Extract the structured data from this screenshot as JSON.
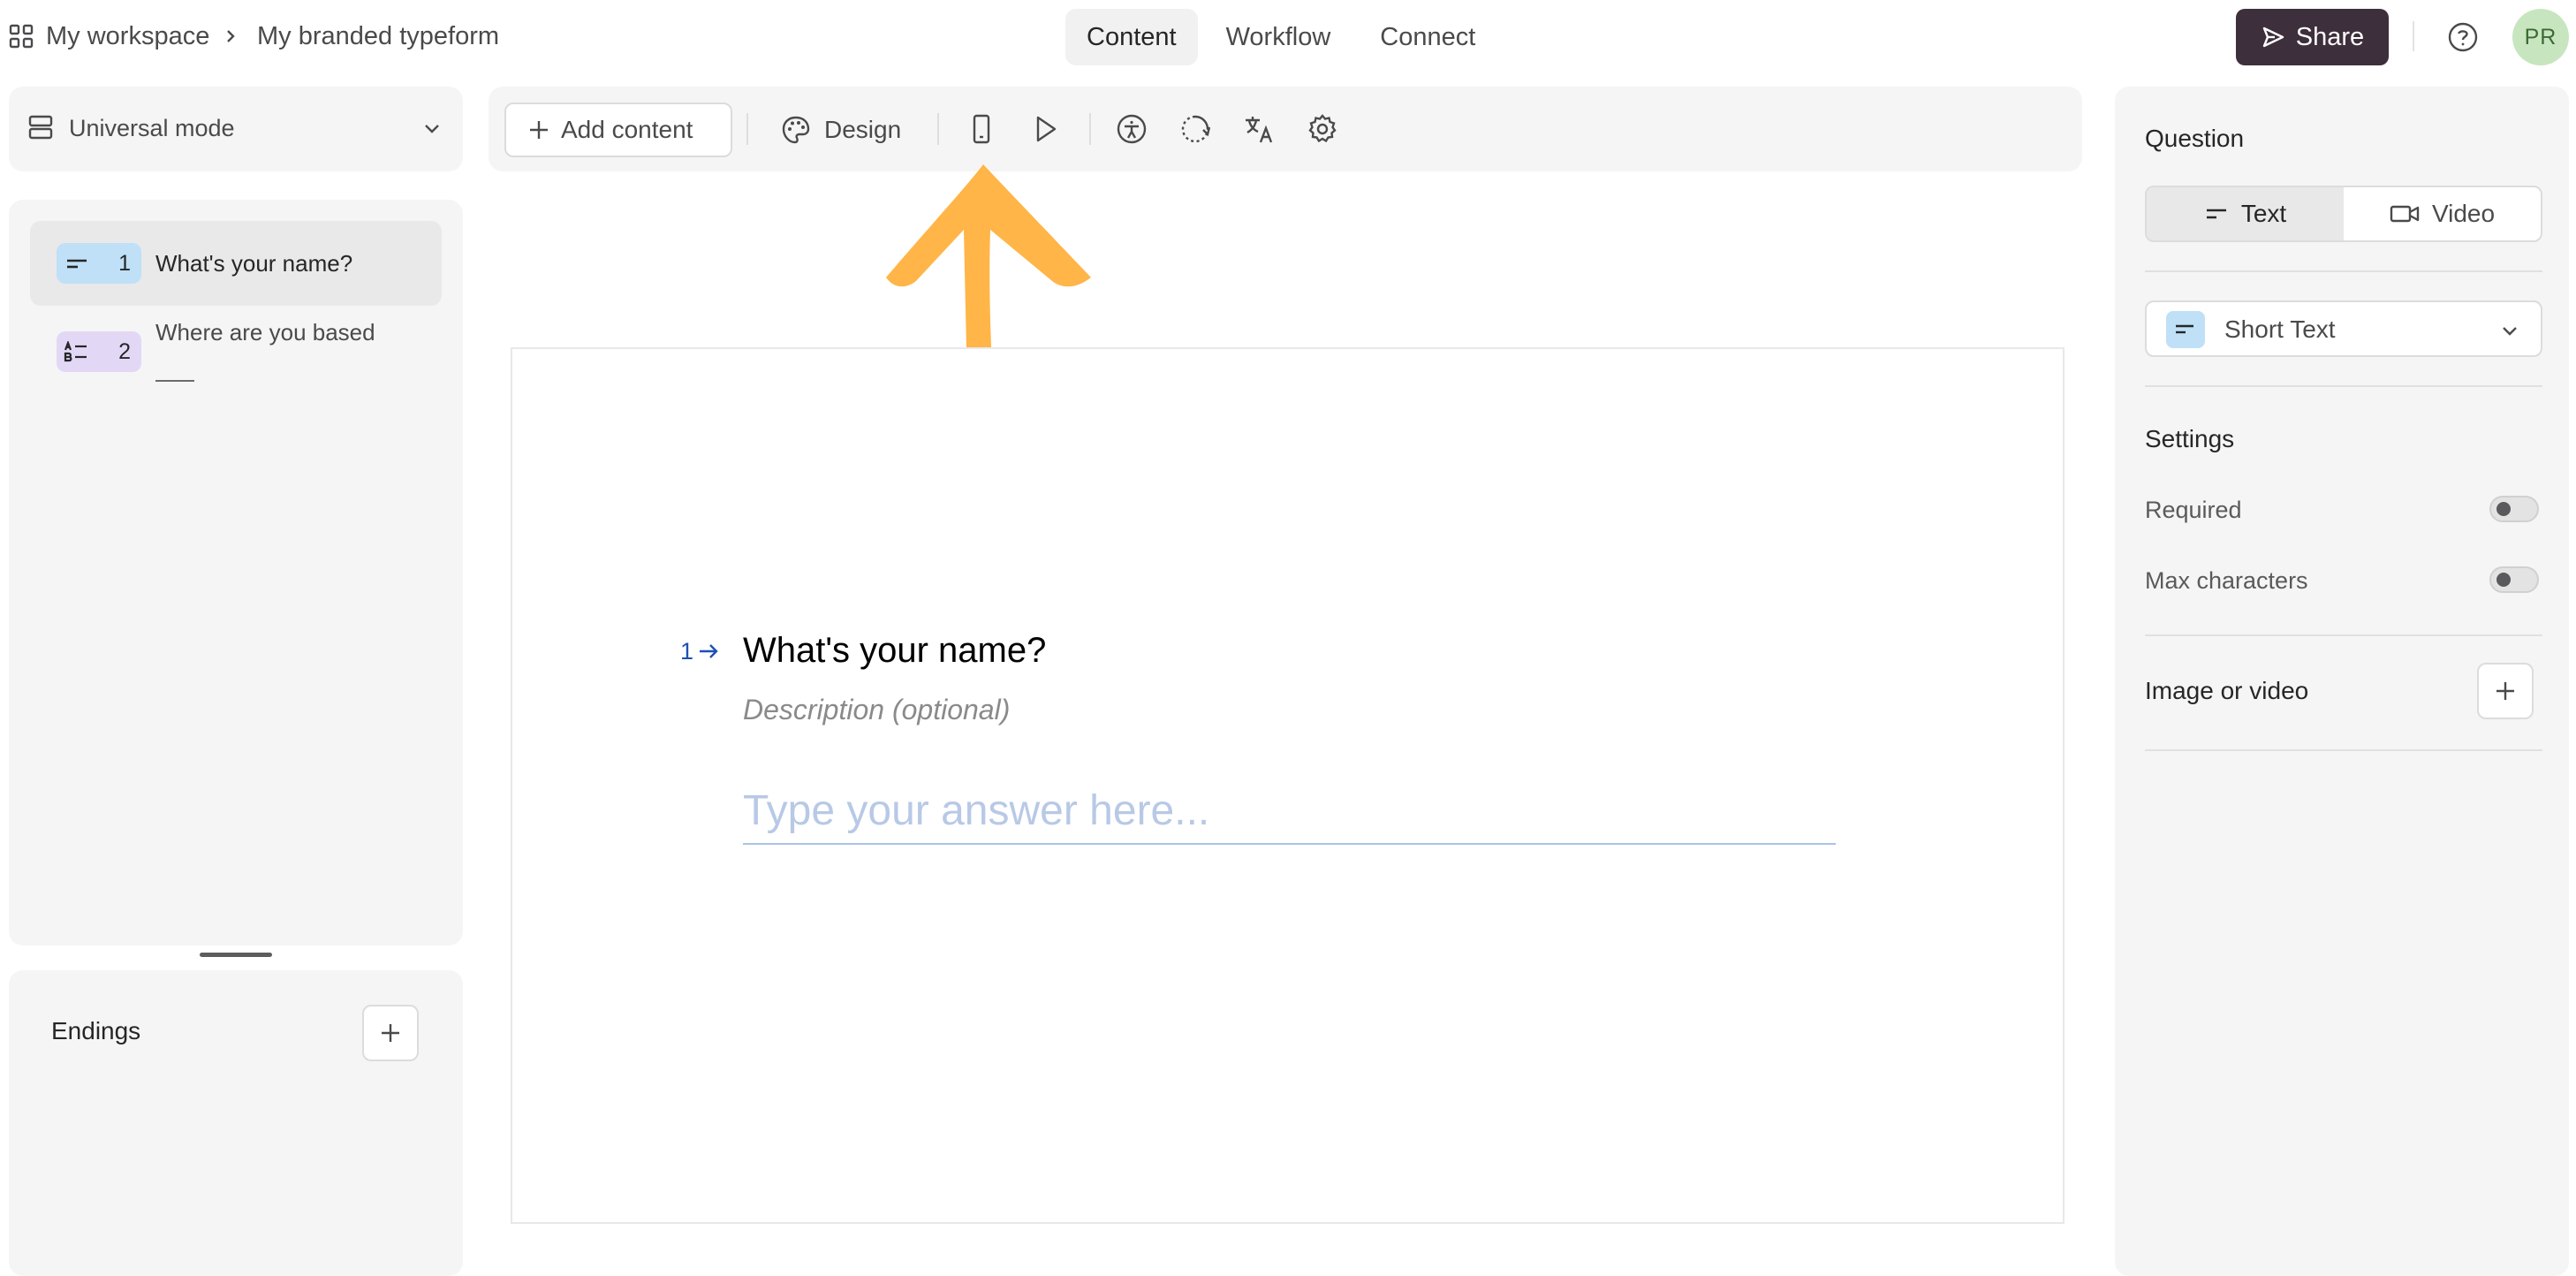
{
  "topbar": {
    "workspace": "My workspace",
    "form_name": "My branded typeform",
    "tabs": [
      {
        "label": "Content",
        "active": true
      },
      {
        "label": "Workflow",
        "active": false
      },
      {
        "label": "Connect",
        "active": false
      }
    ],
    "share_label": "Share",
    "avatar_initials": "PR"
  },
  "left": {
    "mode_label": "Universal mode",
    "questions": [
      {
        "number": "1",
        "label": "What's your name?",
        "type_icon": "short-text-icon",
        "badge_color": "#bfe0f7",
        "selected": true
      },
      {
        "number": "2",
        "label": "Where are you based",
        "type_icon": "multiple-choice-icon",
        "badge_color": "#e2d8f6",
        "selected": false
      }
    ],
    "endings_label": "Endings"
  },
  "toolbar": {
    "add_content_label": "Add content",
    "design_label": "Design",
    "icons": [
      "mobile-preview-icon",
      "play-icon",
      "accessibility-icon",
      "refresh-icon",
      "translate-icon",
      "settings-icon"
    ]
  },
  "annotation": {
    "arrow_color": "#ffb547"
  },
  "canvas": {
    "question_number": "1",
    "question_title": "What's your name?",
    "description_placeholder": "Description (optional)",
    "answer_placeholder": "Type your answer here..."
  },
  "right": {
    "question_heading": "Question",
    "seg_text": "Text",
    "seg_video": "Video",
    "question_type": "Short Text",
    "settings_heading": "Settings",
    "required_label": "Required",
    "max_chars_label": "Max characters",
    "media_label": "Image or video"
  },
  "colors": {
    "share_bg": "#3d2f3b",
    "accent_blue": "#1e4fb5",
    "avatar_bg": "#c7e6c0"
  }
}
